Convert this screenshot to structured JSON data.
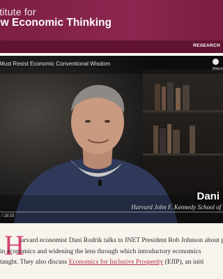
{
  "header": {
    "brand_line1": "stitute for",
    "brand_line2": "ew Economic Thinking"
  },
  "nav": {
    "item": "RESEARCH"
  },
  "video": {
    "title": "Must Resist Economic Conventional Wisdom",
    "watch_label": "Watch",
    "speaker_name": "Dani R",
    "speaker_affiliation": "Harvard John F. Kennedy School of G",
    "timecode": "/ 18:33"
  },
  "article": {
    "dropcap": "H",
    "line1": "arvard economist Dani Rodrik talks to INET President Rob Johnson about p",
    "line2": "in economics and widening the lens through which introductory economics",
    "line3_prefix": "taught. They also discuss ",
    "line3_link": "Economics for Inclusive Prosperity",
    "line3_suffix": " (EfIP), an initi"
  },
  "colors": {
    "header_bg": "#861f4a",
    "nav_bg": "#611332",
    "accent": "#d5406c",
    "page_bg": "#f7f4ee"
  }
}
